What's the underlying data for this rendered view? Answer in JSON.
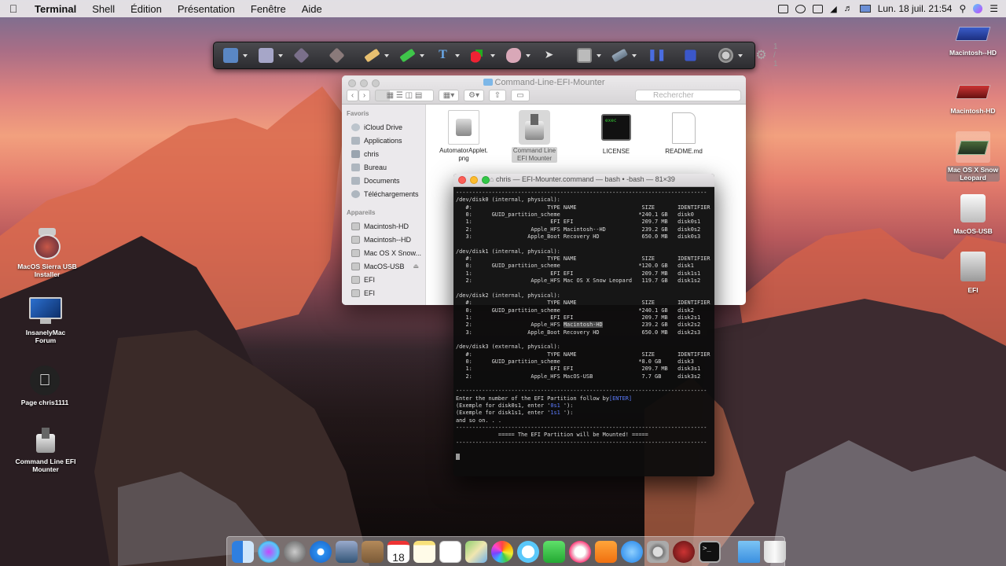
{
  "menubar": {
    "app_name": "Terminal",
    "menus": [
      "Shell",
      "Édition",
      "Présentation",
      "Fenêtre",
      "Aide"
    ],
    "clock": "Lun. 18 juil.  21:54"
  },
  "toolbar": {
    "page_indicator": "1 / 1"
  },
  "finder": {
    "title": "Command-Line-EFI-Mounter",
    "search_placeholder": "Rechercher",
    "favorites_header": "Favoris",
    "favorites": [
      "iCloud Drive",
      "Applications",
      "chris",
      "Bureau",
      "Documents",
      "Téléchargements"
    ],
    "devices_header": "Appareils",
    "devices": [
      "Macintosh-HD",
      "Macintosh--HD",
      "Mac OS X Snow...",
      "MacOS-USB",
      "EFI",
      "EFI"
    ],
    "files": [
      {
        "label": "AutomatorApplet.\npng",
        "icon": "automator-image-icon"
      },
      {
        "label": "Command Line\nEFI Mounter",
        "icon": "efi-mounter-app-icon"
      },
      {
        "label": "LICENSE",
        "icon": "exec-file-icon"
      },
      {
        "label": "README.md",
        "icon": "document-icon"
      }
    ]
  },
  "terminal": {
    "title": "chris — EFI-Mounter.command — bash • -bash — 81×39",
    "lines": [
      "-----------------------------------------------------------------------------",
      "/dev/disk0 (internal, physical):",
      "   #:                       TYPE NAME                    SIZE       IDENTIFIER",
      "   0:      GUID_partition_scheme                        *240.1 GB   disk0",
      "   1:                        EFI EFI                     209.7 MB   disk0s1",
      "   2:                  Apple_HFS Macintosh--HD           239.2 GB   disk0s2",
      "   3:                 Apple_Boot Recovery HD             650.0 MB   disk0s3",
      "",
      "/dev/disk1 (internal, physical):",
      "   #:                       TYPE NAME                    SIZE       IDENTIFIER",
      "   0:      GUID_partition_scheme                        *120.0 GB   disk1",
      "   1:                        EFI EFI                     209.7 MB   disk1s1",
      "   2:                  Apple_HFS Mac OS X Snow Leopard   119.7 GB   disk1s2",
      "",
      "/dev/disk2 (internal, physical):",
      "   #:                       TYPE NAME                    SIZE       IDENTIFIER",
      "   0:      GUID_partition_scheme                        *240.1 GB   disk2",
      "   1:                        EFI EFI                     209.7 MB   disk2s1",
      "   2:                  Apple_HFS Macintosh-HD            239.2 GB   disk2s2",
      "   3:                 Apple_Boot Recovery HD             650.0 MB   disk2s3",
      "",
      "/dev/disk3 (external, physical):",
      "   #:                       TYPE NAME                    SIZE       IDENTIFIER",
      "   0:      GUID_partition_scheme                        *8.0 GB     disk3",
      "   1:                        EFI EFI                     209.7 MB   disk3s1",
      "   2:                  Apple_HFS MacOS-USB               7.7 GB     disk3s2",
      "",
      "-----------------------------------------------------------------------------",
      "Enter the number of the EFI Partition follow by[ENTER]",
      "(Exemple for disk0s1, enter '0s1 '):",
      "(Exemple for disk1s1, enter '1s1 '):",
      "and so on. . .",
      "-----------------------------------------------------------------------------",
      "             ===== The EFI Partition will be Mounted! =====",
      "-----------------------------------------------------------------------------"
    ]
  },
  "desktop_left": [
    {
      "label": "MacOS Sierra USB\nInstaller",
      "icon": "sierra-installer-icon"
    },
    {
      "label": "InsanelyMac\nForum",
      "icon": "imac-icon"
    },
    {
      "label": "Page chris1111",
      "icon": "apple-logo-icon"
    },
    {
      "label": "Command Line EFI\nMounter",
      "icon": "efi-mounter-app-icon"
    }
  ],
  "desktop_right": [
    {
      "label": "Macintosh--HD",
      "icon": "hard-drive-icon"
    },
    {
      "label": "Macintosh-HD",
      "icon": "hard-drive-icon"
    },
    {
      "label": "Mac OS X Snow\nLeopard",
      "icon": "hard-drive-icon"
    },
    {
      "label": "MacOS-USB",
      "icon": "usb-drive-icon"
    },
    {
      "label": "EFI",
      "icon": "efi-drive-icon"
    }
  ],
  "dock": {
    "apps": [
      "finder-icon",
      "siri-icon",
      "launchpad-icon",
      "safari-icon",
      "preview-icon",
      "contacts-icon",
      "calendar-icon",
      "notes-icon",
      "reminders-icon",
      "maps-icon",
      "photos-icon",
      "messages-icon",
      "facetime-icon",
      "itunes-icon",
      "ibooks-icon",
      "app-store-icon",
      "system-preferences-icon",
      "installer-icon",
      "terminal-icon"
    ],
    "calendar_day": "18",
    "right": [
      "downloads-folder-icon",
      "trash-icon"
    ]
  }
}
